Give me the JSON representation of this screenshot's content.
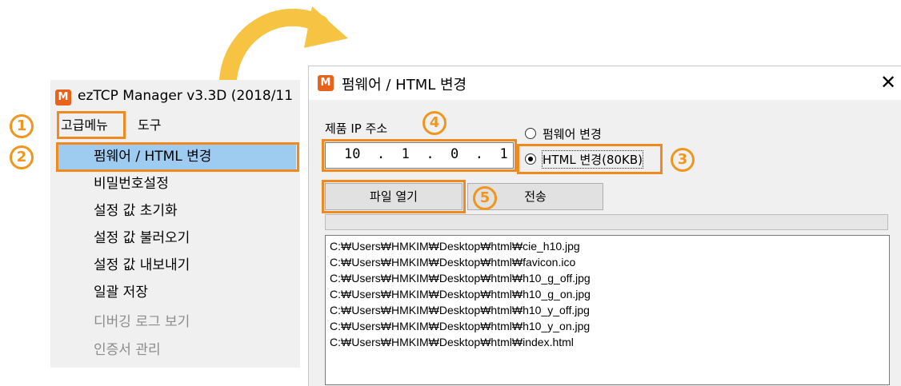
{
  "left_window": {
    "app_icon_letter": "M",
    "title": "ezTCP Manager v3.3D (2018/11",
    "menubar": {
      "advanced_menu": "고급메뉴",
      "tools": "도구"
    },
    "menu_items": [
      {
        "label": "펌웨어 / HTML 변경",
        "state": "highlighted"
      },
      {
        "label": "비밀번호설정",
        "state": "enabled"
      },
      {
        "label": "설정 값 초기화",
        "state": "enabled"
      },
      {
        "label": "설정 값 불러오기",
        "state": "enabled"
      },
      {
        "label": "설정 값 내보내기",
        "state": "enabled"
      },
      {
        "label": "일괄 저장",
        "state": "enabled"
      },
      {
        "label": "디버깅 로그 보기",
        "state": "disabled"
      },
      {
        "label": "인증서 관리",
        "state": "disabled"
      }
    ]
  },
  "dialog": {
    "icon_letter": "M",
    "title": "펌웨어 / HTML 변경",
    "close_glyph": "✕",
    "ip_label": "제품 IP 주소",
    "ip_value": "10  .  1  .  0  .  1",
    "radio_firmware": "펌웨어 변경",
    "radio_html": "HTML 변경(80KB)",
    "radio_selected": "html",
    "open_file_button": "파일 열기",
    "send_button": "전송",
    "progress_percent": 0,
    "files": [
      "C:₩Users₩HMKIM₩Desktop₩html₩cie_h10.jpg",
      "C:₩Users₩HMKIM₩Desktop₩html₩favicon.ico",
      "C:₩Users₩HMKIM₩Desktop₩html₩h10_g_off.jpg",
      "C:₩Users₩HMKIM₩Desktop₩html₩h10_g_on.jpg",
      "C:₩Users₩HMKIM₩Desktop₩html₩h10_y_off.jpg",
      "C:₩Users₩HMKIM₩Desktop₩html₩h10_y_on.jpg",
      "C:₩Users₩HMKIM₩Desktop₩html₩index.html"
    ]
  },
  "annotations": {
    "step1": "1",
    "step2": "2",
    "step3": "3",
    "step4": "4",
    "step5": "5",
    "highlight_color": "#f08a1e",
    "arrow_color": "#f7c342"
  },
  "colors": {
    "menu_highlight": "#9ecbf0",
    "app_icon": "#e8621b"
  }
}
